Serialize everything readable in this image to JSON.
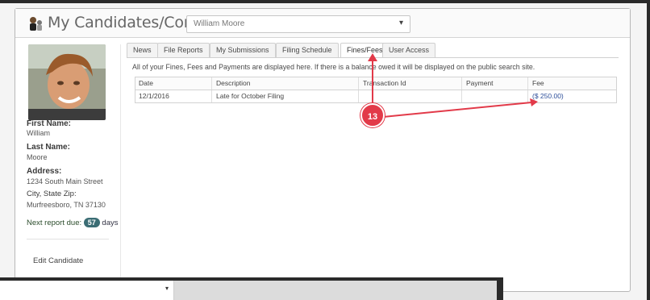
{
  "header": {
    "title": "My Candidates/Committees",
    "selected_candidate": "William Moore"
  },
  "sidebar": {
    "first_name_label": "First Name:",
    "first_name": "William",
    "last_name_label": "Last Name:",
    "last_name": "Moore",
    "address_label": "Address:",
    "address": "1234 South Main Street",
    "city_label": "City, State Zip:",
    "city": "Murfreesboro, TN 37130",
    "next_report_label": "Next report due:",
    "next_report_days": "57",
    "next_report_suffix": "days",
    "edit_link": "Edit Candidate"
  },
  "tabs": [
    {
      "label": "News"
    },
    {
      "label": "File Reports"
    },
    {
      "label": "My Submissions"
    },
    {
      "label": "Filing Schedule"
    },
    {
      "label": "Fines/Fees"
    },
    {
      "label": "User Access"
    }
  ],
  "active_tab": "Fines/Fees",
  "info_text": "All of your Fines, Fees and Payments are displayed here. If there is a balance owed it will be displayed on the public search site.",
  "table": {
    "columns": [
      "Date",
      "Description",
      "Transaction Id",
      "Payment",
      "Fee"
    ],
    "rows": [
      {
        "date": "12/1/2016",
        "description": "Late for October Filing",
        "transaction_id": "",
        "payment": "",
        "fee": "($ 250.00)"
      }
    ]
  },
  "annotation": {
    "number": "13",
    "color": "#e23a49"
  },
  "colors": {
    "badge": "#3b6d74",
    "link": "#2d4f9a"
  }
}
